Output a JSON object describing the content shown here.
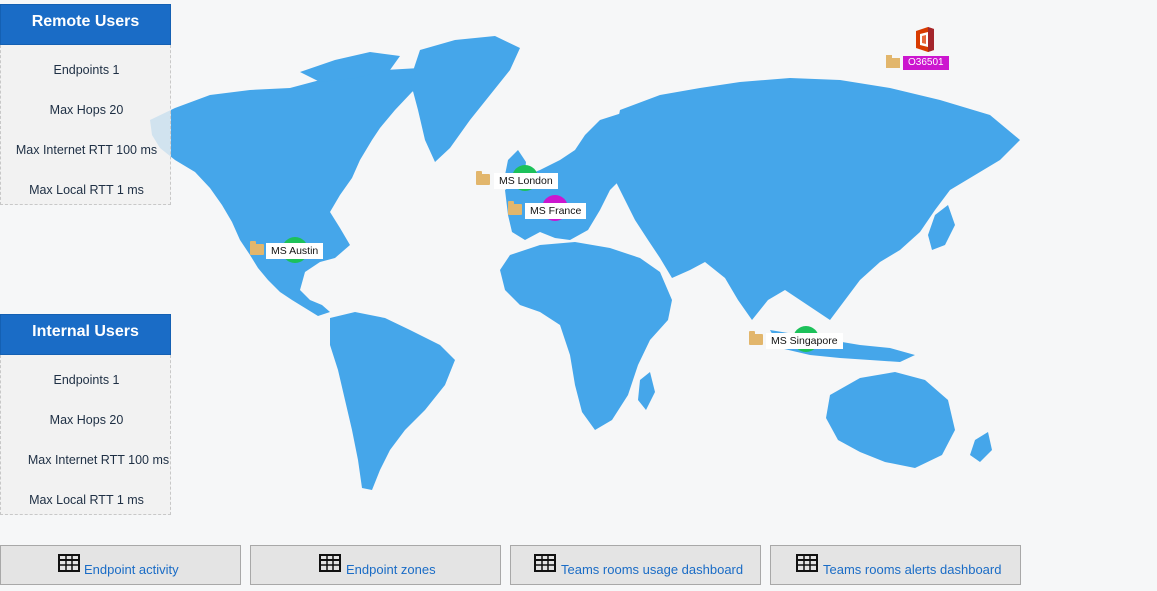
{
  "remote_panel": {
    "title": "Remote Users",
    "rows": [
      "Endpoints 1",
      "Max Hops 20",
      "Max Internet RTT 100 ms",
      "Max Local RTT 1 ms"
    ]
  },
  "internal_panel": {
    "title": "Internal Users",
    "rows": [
      "Endpoints 1",
      "Max Hops 20",
      "Max Internet RTT 100 ms",
      "Max Local RTT 1 ms"
    ]
  },
  "markers": {
    "austin": {
      "label": "MS Austin",
      "status_color": "#1cc15a"
    },
    "london": {
      "label": "MS London",
      "status_color": "#1cc15a"
    },
    "france": {
      "label": "MS France",
      "status_color": "#cc16cf"
    },
    "singapore": {
      "label": "MS Singapore",
      "status_color": "#1cc15a"
    },
    "o365": {
      "label": "O36501",
      "status_color": "#cc16cf",
      "icon": "office-icon"
    }
  },
  "buttons": {
    "endpoint_activity": "Endpoint activity",
    "endpoint_zones": "Endpoint zones",
    "teams_usage": "Teams rooms usage dashboard",
    "teams_alerts": "Teams rooms alerts dashboard"
  },
  "colors": {
    "map_land": "#45a6ea",
    "header_blue": "#1a6cc6",
    "link_blue": "#1a6cc6"
  }
}
